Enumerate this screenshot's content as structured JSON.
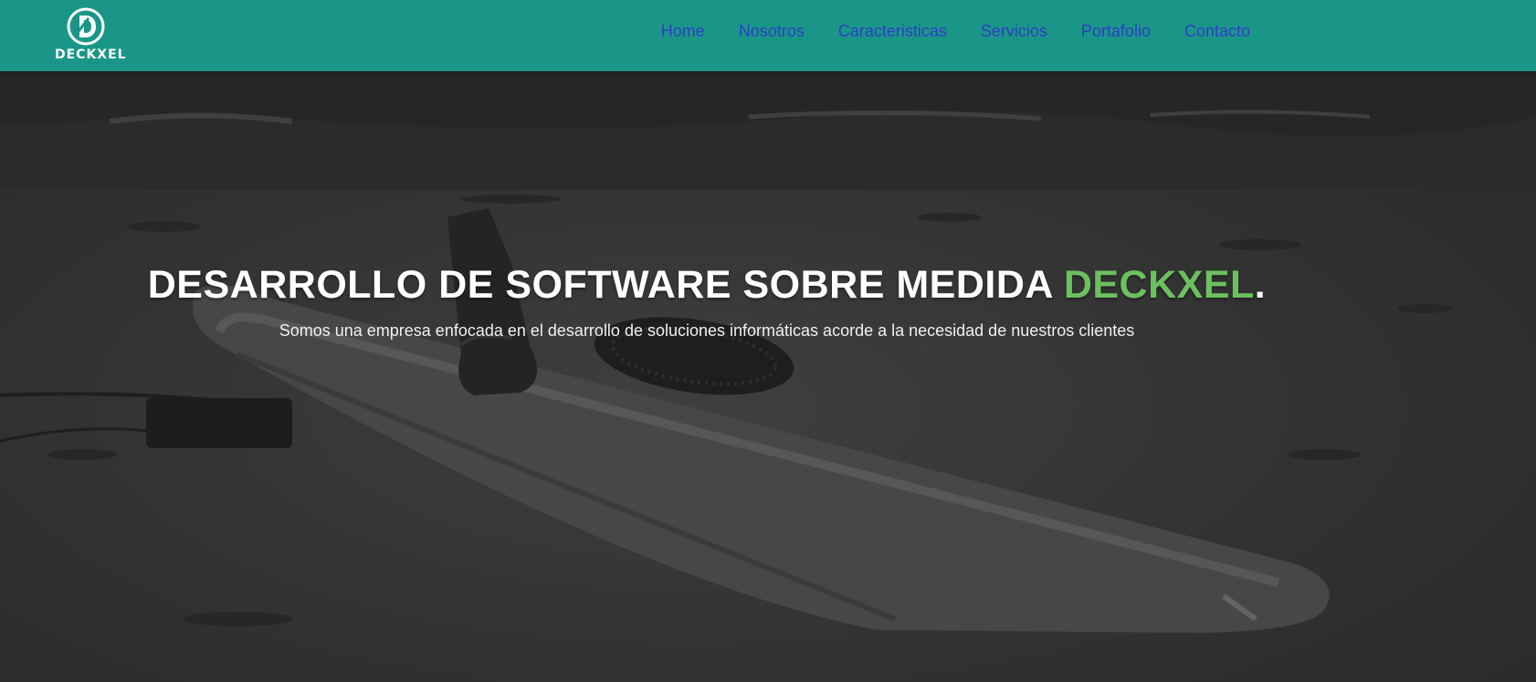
{
  "brand": {
    "name": "DECKXEL",
    "logo_icon": "deckxel-d-logo-icon"
  },
  "nav": {
    "items": [
      {
        "label": "Home"
      },
      {
        "label": "Nosotros"
      },
      {
        "label": "Caracteristicas"
      },
      {
        "label": "Servicios"
      },
      {
        "label": "Portafolio"
      },
      {
        "label": "Contacto"
      }
    ]
  },
  "hero": {
    "title_main": "DESARROLLO DE SOFTWARE SOBRE MEDIDA ",
    "title_accent": "DECKXEL",
    "title_end": ".",
    "subtitle": "Somos una empresa enfocada en el desarrollo de soluciones informáticas acorde a la necesidad de nuestros clientes"
  },
  "colors": {
    "header_bg": "#1a9688",
    "nav_link": "#2d3fc4",
    "accent": "#6cc05f",
    "hero_text": "#ffffff"
  }
}
